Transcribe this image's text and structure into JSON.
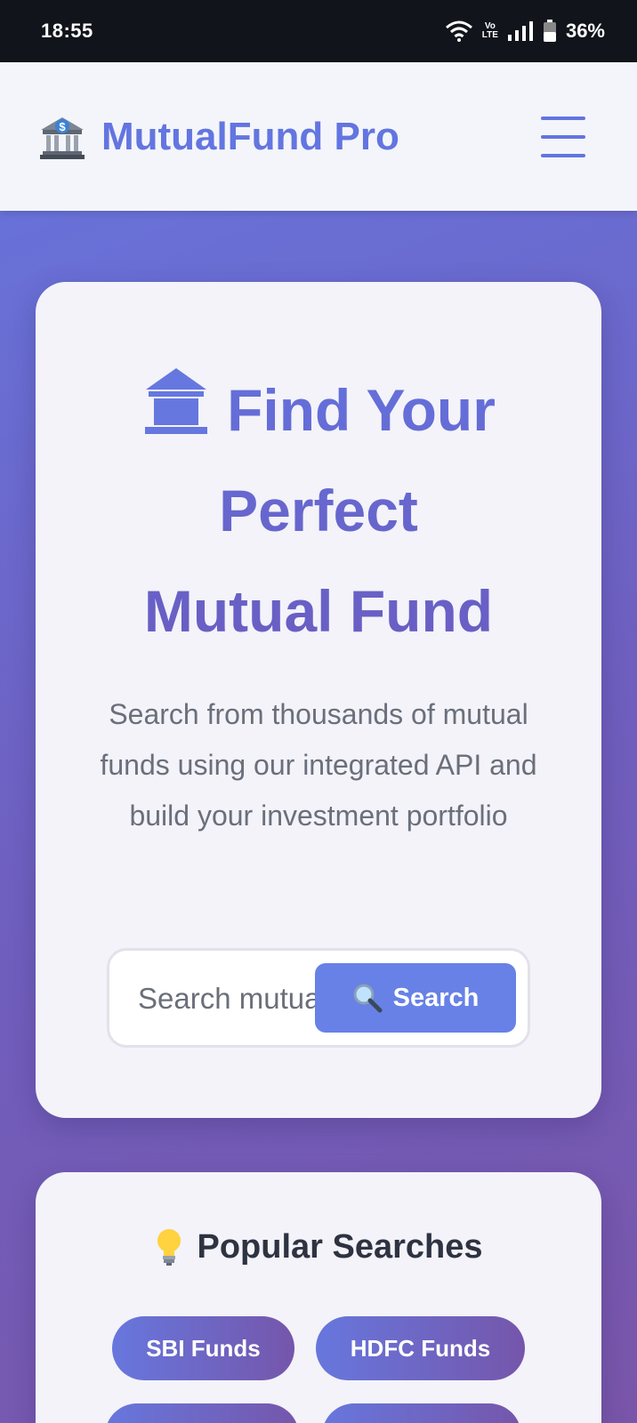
{
  "status_bar": {
    "time": "18:55",
    "lte_top": "Vo",
    "lte_bottom": "LTE",
    "battery": "36%",
    "icons": [
      "wifi-icon",
      "volte-icon",
      "signal-icon",
      "battery-icon"
    ]
  },
  "header": {
    "logo_icon": "bank-dollar-icon",
    "brand": "MutualFund Pro",
    "menu_icon": "hamburger-icon"
  },
  "hero": {
    "icon": "bank-icon",
    "title_line1": "Find Your",
    "title_line2": "Perfect",
    "title_line3": "Mutual Fund",
    "description": "Search from thousands of mutual funds using our integrated API and build your investment portfolio",
    "search_placeholder": "Search mutual funds...",
    "search_button": "Search",
    "search_icon": "magnifier-icon"
  },
  "popular": {
    "icon": "lightbulb-icon",
    "title": "Popular Searches",
    "chips": [
      "SBI Funds",
      "HDFC Funds"
    ]
  },
  "colors": {
    "accent": "#6375e0",
    "gradient_start": "#6677e0",
    "gradient_end": "#7a56aa",
    "button": "#6781e6",
    "card": "#f3f3f9"
  }
}
